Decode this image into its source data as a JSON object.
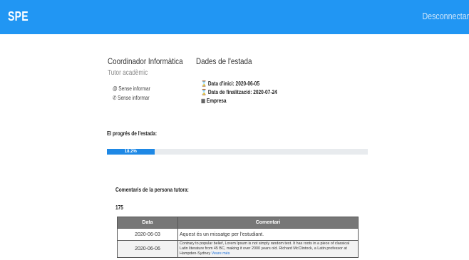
{
  "header": {
    "brand": "SPE",
    "logout_label": "Desconnectar",
    "bar_color": "#2196f3"
  },
  "tutor": {
    "name": "Coordinador Informàtica",
    "role": "Tutor acadèmic",
    "email": "Sense informar",
    "phone": "Sense informar"
  },
  "stay": {
    "title": "Dades de l'estada",
    "start_label": "Data d'inici: 2020-06-05",
    "end_label": "Data de finalització: 2020-07-24",
    "company_label": "Empresa"
  },
  "progress": {
    "label": "El progrés de l'estada:",
    "percent": 18.2,
    "text": "18.2%",
    "color": "#1e88e5"
  },
  "comments": {
    "label": "Comentaris de la persona tutora:",
    "count": "175",
    "columns": [
      "Data",
      "Comentari"
    ],
    "rows": [
      {
        "date": "2020-06-03",
        "text": "Aquest és un missatge per l'estudiant."
      },
      {
        "date": "2020-06-06",
        "text": "Contrary to popular belief, Lorem Ipsum is not simply random text. It has roots in a piece of classical Latin literature from 45 BC, making it over 2000 years old. Richard McClintock, a Latin professor at Hampden-Sydney",
        "more": "Veure més"
      }
    ]
  }
}
